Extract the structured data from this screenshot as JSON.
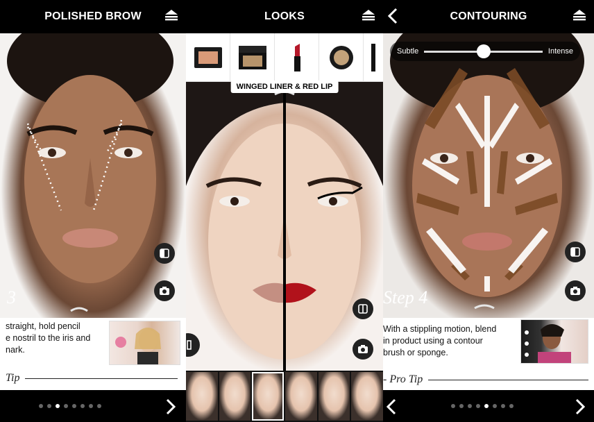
{
  "panels": {
    "brow": {
      "title": "POLISHED BROW",
      "step": "3",
      "description_lines": [
        " straight, hold pencil",
        "e nostril to the iris and",
        "nark."
      ],
      "pro_tip": "Tip",
      "dots_total": 8,
      "dots_active": 2
    },
    "looks": {
      "title": "LOOKS",
      "look_label": "WINGED LINER & RED LIP",
      "products": [
        "blush-compact",
        "bronzer-compact",
        "lipstick",
        "eyeshadow-pot",
        "eyeliner"
      ],
      "thumbs_count": 6,
      "selected_thumb": 2
    },
    "contouring": {
      "title": "CONTOURING",
      "slider": {
        "min_label": "Subtle",
        "max_label": "Intense",
        "value": 0.5
      },
      "step": "Step 4",
      "description_lines": [
        "With a stippling motion, blend",
        "in product using a contour",
        "brush or sponge."
      ],
      "pro_tip": "- Pro Tip",
      "dots_total": 8,
      "dots_active": 4
    }
  },
  "icons": {
    "menu": "menu-icon",
    "back": "chevron-left-icon",
    "next": "chevron-right-icon",
    "compare": "compare-split-icon",
    "camera": "camera-icon"
  },
  "colors": {
    "bar": "#000000",
    "contour_brown": "#7a4a26",
    "highlight_white": "#ffffff",
    "lip_red": "#b1121b"
  }
}
